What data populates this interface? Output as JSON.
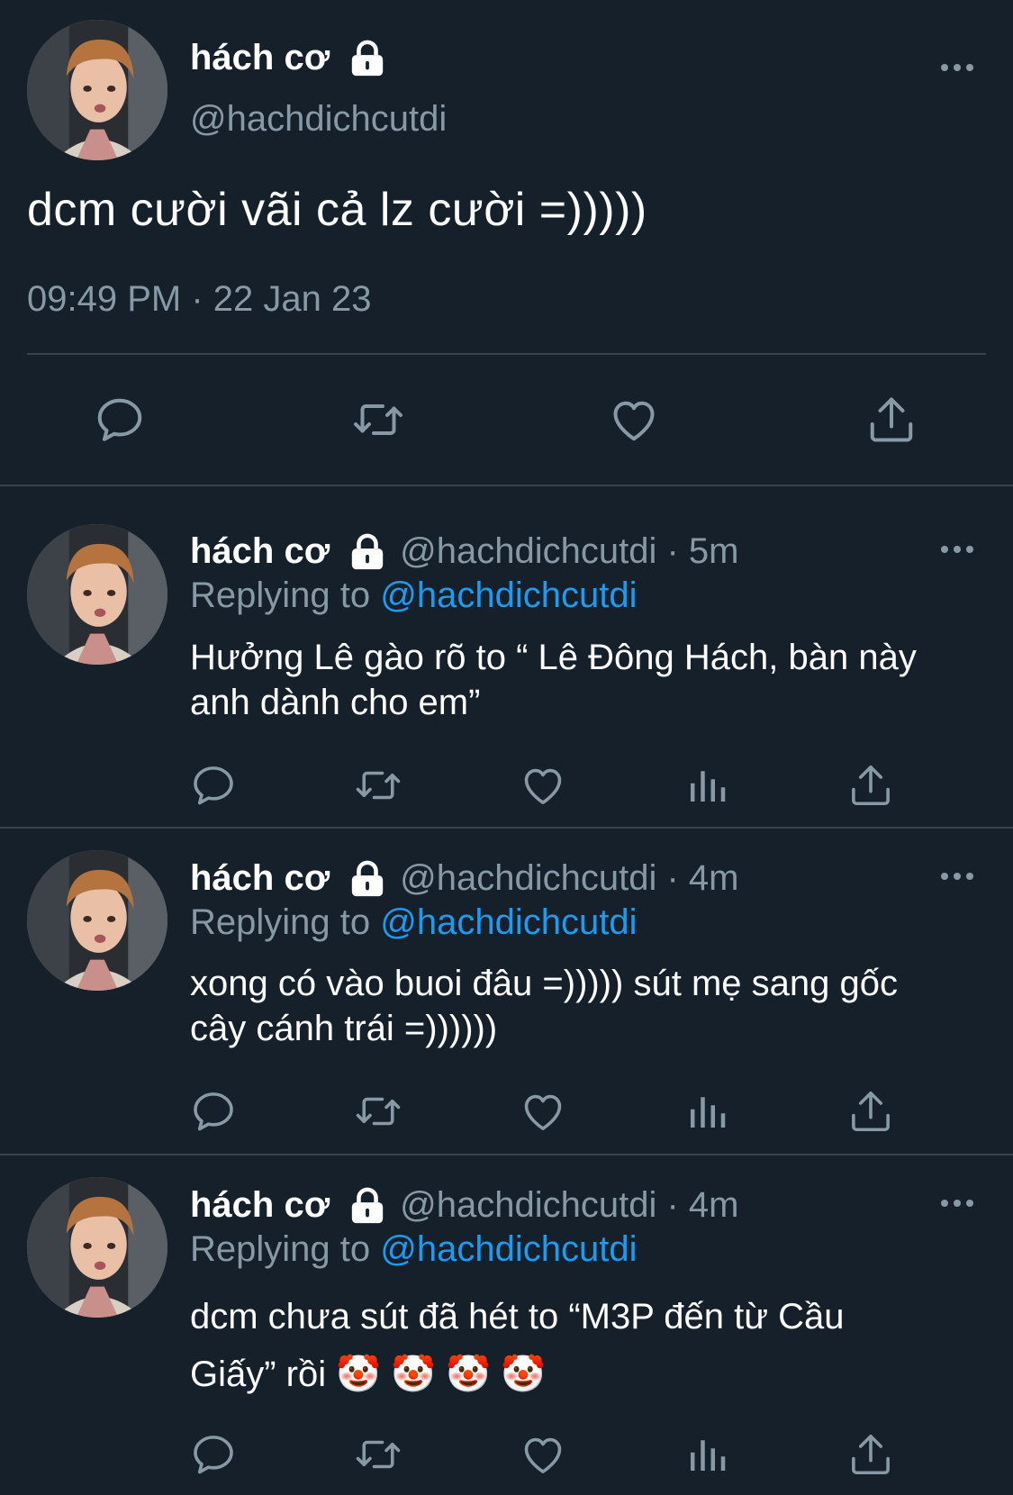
{
  "main_tweet": {
    "display_name": "hách cơ",
    "handle": "@hachdichcutdi",
    "text": "dcm cười vãi cả lz cười =)))))",
    "timestamp": "09:49 PM · 22 Jan 23"
  },
  "replies": [
    {
      "display_name": "hách cơ",
      "handle_time": "@hachdichcutdi · 5m",
      "replying_prefix": "Replying to ",
      "replying_handle": "@hachdichcutdi",
      "text": "Hưởng Lê gào rõ to “ Lê Đông Hách, bàn này anh dành cho em”"
    },
    {
      "display_name": "hách cơ",
      "handle_time": "@hachdichcutdi · 4m",
      "replying_prefix": "Replying to ",
      "replying_handle": "@hachdichcutdi",
      "text": "xong có vào buoi đâu =))))) sút mẹ sang gốc cây cánh trái =))))))"
    },
    {
      "display_name": "hách cơ",
      "handle_time": "@hachdichcutdi · 4m",
      "replying_prefix": "Replying to ",
      "replying_handle": "@hachdichcutdi",
      "text": "dcm chưa sút đã hét to “M3P đến từ Cầu Giấy” rồi 🤡 🤡 🤡 🤡"
    }
  ],
  "icons": {
    "reply": "reply-icon",
    "retweet": "retweet-icon",
    "like": "like-icon",
    "analytics": "analytics-icon",
    "share": "share-icon",
    "lock": "lock-icon",
    "more": "more-icon"
  },
  "colors": {
    "background": "#15202b",
    "secondary_text": "#8899a6",
    "link": "#1d9bf0",
    "divider": "#38444d"
  }
}
